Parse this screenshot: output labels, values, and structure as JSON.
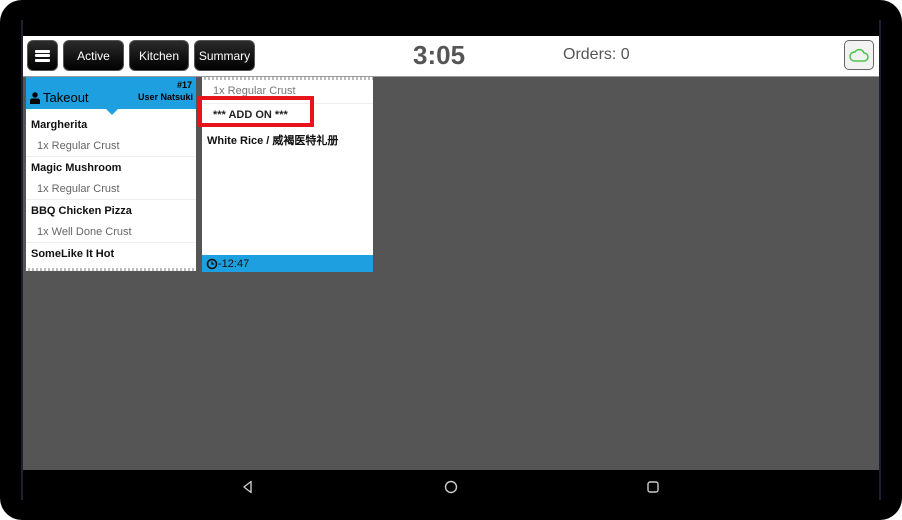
{
  "topbar": {
    "menu_icon": "hamburger-menu-icon",
    "tabs": [
      {
        "label": "Active"
      },
      {
        "label": "Kitchen"
      },
      {
        "label": "Summary"
      }
    ],
    "clock": "3:05",
    "orders": "Orders: 0",
    "cloud_icon": "cloud-sync-icon",
    "cloud_color": "#4cc44a"
  },
  "tickets": [
    {
      "header_color": "#1e9fe0",
      "type_icon": "user-icon",
      "type": "Takeout",
      "number": "#17",
      "user": "User Natsuki",
      "rows": [
        {
          "kind": "item",
          "text": "Margherita"
        },
        {
          "kind": "mod",
          "text": "1x Regular Crust"
        },
        {
          "kind": "item",
          "text": "Magic Mushroom"
        },
        {
          "kind": "mod",
          "text": "1x Regular Crust"
        },
        {
          "kind": "item",
          "text": "BBQ Chicken Pizza"
        },
        {
          "kind": "mod",
          "text": "1x Well Done Crust"
        },
        {
          "kind": "item",
          "text": "SomeLike It Hot"
        }
      ]
    },
    {
      "continued_row": "1x Regular Crust",
      "addon": "*** ADD ON ***",
      "item": "White Rice / 威褐医特礼册",
      "timer_icon": "clock-icon",
      "timer": "-12:47"
    }
  ],
  "highlight_color": "#e8141b",
  "navbar": {
    "back_icon": "back-triangle-icon",
    "home_icon": "home-circle-icon",
    "recents_icon": "recents-square-icon"
  }
}
